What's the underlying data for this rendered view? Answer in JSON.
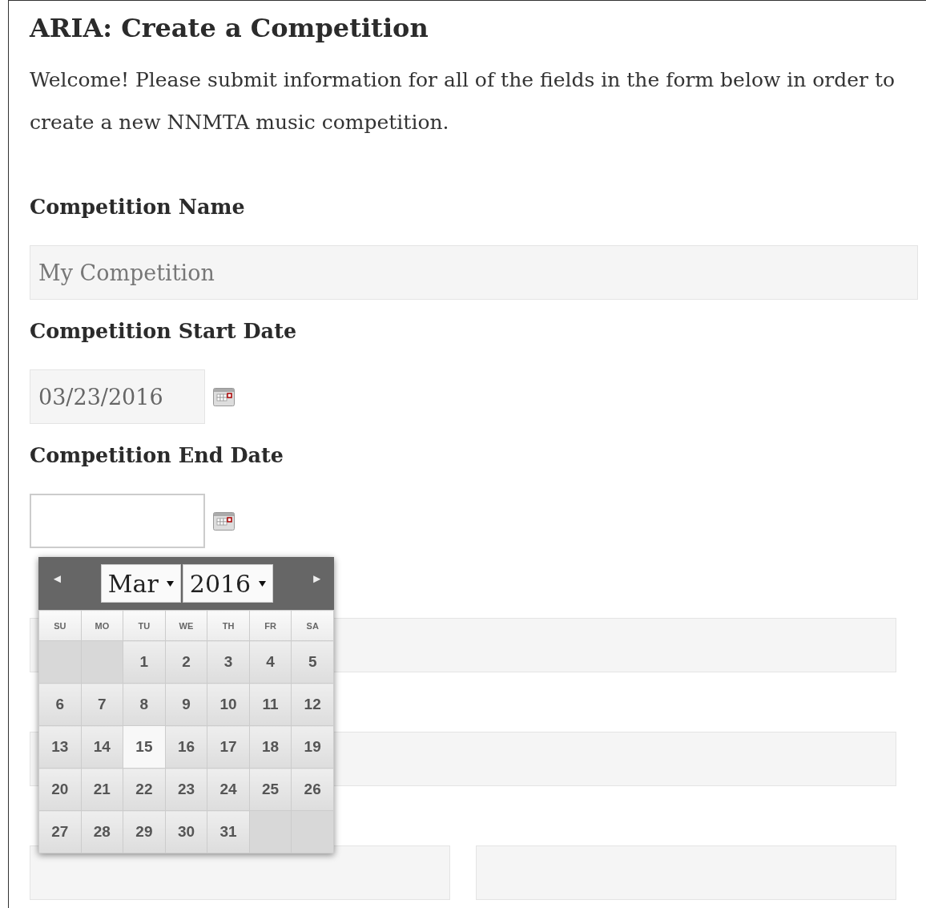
{
  "title": "ARIA: Create a Competition",
  "intro": "Welcome! Please submit information for all of the fields in the form below in order to create a new NNMTA music competition.",
  "fields": [
    {
      "kind": "text",
      "label": "Competition Name",
      "placeholder": "My Competition",
      "focused": false
    },
    {
      "kind": "date",
      "label": "Competition Start Date",
      "value": "03/23/2016",
      "focused": false
    },
    {
      "kind": "date",
      "label": "Competition End Date",
      "focused": true
    }
  ],
  "lower_rows": [
    {
      "kind": "single"
    },
    {
      "kind": "single"
    },
    {
      "kind": "double"
    }
  ],
  "calendar": {
    "prev": "◄",
    "next": "►",
    "month": "Mar",
    "year": "2016",
    "weekdays": [
      "SU",
      "MO",
      "TU",
      "WE",
      "TH",
      "FR",
      "SA"
    ],
    "weeks": [
      [
        {
          "kind": "blank"
        },
        {
          "kind": "blank"
        },
        {
          "kind": "day",
          "label": "1",
          "today": false
        },
        {
          "kind": "day",
          "label": "2",
          "today": false
        },
        {
          "kind": "day",
          "label": "3",
          "today": false
        },
        {
          "kind": "day",
          "label": "4",
          "today": false
        },
        {
          "kind": "day",
          "label": "5",
          "today": false
        }
      ],
      [
        {
          "kind": "day",
          "label": "6",
          "today": false
        },
        {
          "kind": "day",
          "label": "7",
          "today": false
        },
        {
          "kind": "day",
          "label": "8",
          "today": false
        },
        {
          "kind": "day",
          "label": "9",
          "today": false
        },
        {
          "kind": "day",
          "label": "10",
          "today": false
        },
        {
          "kind": "day",
          "label": "11",
          "today": false
        },
        {
          "kind": "day",
          "label": "12",
          "today": false
        }
      ],
      [
        {
          "kind": "day",
          "label": "13",
          "today": false
        },
        {
          "kind": "day",
          "label": "14",
          "today": false
        },
        {
          "kind": "day",
          "label": "15",
          "today": true
        },
        {
          "kind": "day",
          "label": "16",
          "today": false
        },
        {
          "kind": "day",
          "label": "17",
          "today": false
        },
        {
          "kind": "day",
          "label": "18",
          "today": false
        },
        {
          "kind": "day",
          "label": "19",
          "today": false
        }
      ],
      [
        {
          "kind": "day",
          "label": "20",
          "today": false
        },
        {
          "kind": "day",
          "label": "21",
          "today": false
        },
        {
          "kind": "day",
          "label": "22",
          "today": false
        },
        {
          "kind": "day",
          "label": "23",
          "today": false
        },
        {
          "kind": "day",
          "label": "24",
          "today": false
        },
        {
          "kind": "day",
          "label": "25",
          "today": false
        },
        {
          "kind": "day",
          "label": "26",
          "today": false
        }
      ],
      [
        {
          "kind": "day",
          "label": "27",
          "today": false
        },
        {
          "kind": "day",
          "label": "28",
          "today": false
        },
        {
          "kind": "day",
          "label": "29",
          "today": false
        },
        {
          "kind": "day",
          "label": "30",
          "today": false
        },
        {
          "kind": "day",
          "label": "31",
          "today": false
        },
        {
          "kind": "blank"
        },
        {
          "kind": "blank"
        }
      ]
    ]
  }
}
